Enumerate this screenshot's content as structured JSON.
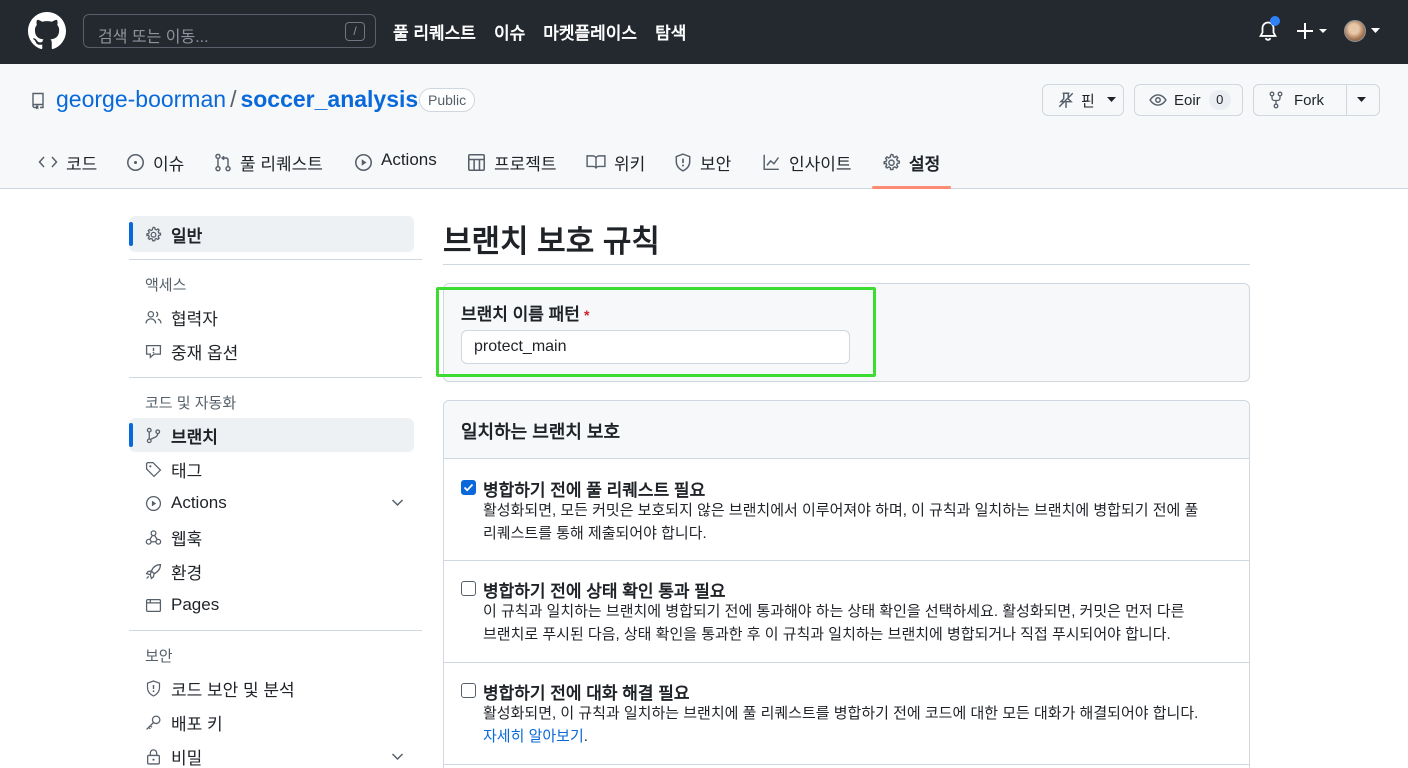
{
  "topbar": {
    "search_placeholder": "검색 또는 이동...",
    "search_shortcut": "/",
    "nav": [
      "풀 리퀘스트",
      "이슈",
      "마켓플레이스",
      "탐색"
    ]
  },
  "repo": {
    "owner": "george-boorman",
    "separator": "/",
    "name": "soccer_analysis",
    "visibility": "Public",
    "pin_label": "핀",
    "watch_label": "Eoir",
    "watch_count": "0",
    "fork_label": "Fork"
  },
  "tabs": [
    "코드",
    "이슈",
    "풀 리퀘스트",
    "Actions",
    "프로젝트",
    "위키",
    "보안",
    "인사이트",
    "설정"
  ],
  "sidebar": {
    "general": "일반",
    "access_heading": "액세스",
    "collaborators": "협력자",
    "moderation": "중재 옵션",
    "code_heading": "코드 및 자동화",
    "branches": "브랜치",
    "tags": "태그",
    "actions": "Actions",
    "webhooks": "웹훅",
    "environments": "환경",
    "pages": "Pages",
    "security_heading": "보안",
    "code_security": "코드 보안 및 분석",
    "deploy_keys": "배포 키",
    "secrets": "비밀"
  },
  "main": {
    "title": "브랜치 보호 규칙",
    "pattern_label": "브랜치 이름 패턴",
    "pattern_required": "*",
    "pattern_value": "protect_main",
    "section_title": "일치하는 브랜치 보호",
    "rules": [
      {
        "title": "병합하기 전에 풀 리퀘스트 필요",
        "checked": true,
        "desc_line1": "활성화되면, 모든 커밋은 보호되지 않은 브랜치에서 이루어져야 하며, 이 규칙과 일치하는 브랜치에 병합되기 전에 풀",
        "desc_line2": "리퀘스트를 통해 제출되어야 합니다."
      },
      {
        "title": "병합하기 전에 상태 확인 통과 필요",
        "checked": false,
        "desc_line1": "이 규칙과 일치하는 브랜치에 병합되기 전에 통과해야 하는 상태 확인을 선택하세요. 활성화되면, 커밋은 먼저 다른",
        "desc_line2": "브랜치로 푸시된 다음, 상태 확인을 통과한 후 이 규칙과 일치하는 브랜치에 병합되거나 직접 푸시되어야 합니다."
      },
      {
        "title": "병합하기 전에 대화 해결 필요",
        "checked": false,
        "desc_line1": "활성화되면, 이 규칙과 일치하는 브랜치에 풀 리퀘스트를 병합하기 전에 코드에 대한 모든 대화가 해결되어야 합니다.",
        "link": "자세히 알아보기",
        "link_suffix": "."
      }
    ]
  },
  "colors": {
    "topbar": "#24292f",
    "accent": "#0969da",
    "active_tab_underline": "#fd8c73",
    "highlight_box": "#3ddc33"
  }
}
